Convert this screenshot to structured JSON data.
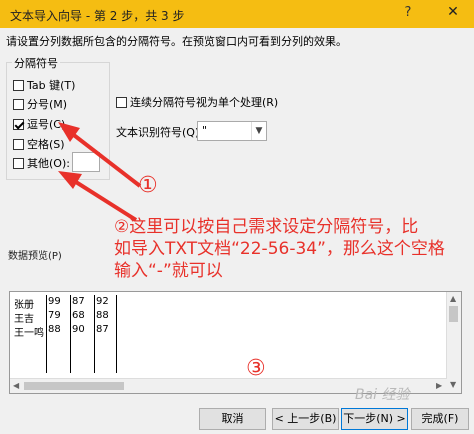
{
  "window": {
    "title": "文本导入向导 - 第 2 步，共 3 步",
    "help": "?",
    "close": "✕"
  },
  "instruction": "请设置分列数据所包含的分隔符号。在预览窗口内可看到分列的效果。",
  "delimiters": {
    "group_label": "分隔符号",
    "tab": {
      "label": "Tab 键(T)",
      "checked": false
    },
    "semicolon": {
      "label": "分号(M)",
      "checked": false
    },
    "comma": {
      "label": "逗号(C)",
      "checked": true
    },
    "space": {
      "label": "空格(S)",
      "checked": false
    },
    "other": {
      "label": "其他(O):",
      "checked": false,
      "value": ""
    }
  },
  "consecutive": {
    "label": "连续分隔符号视为单个处理(R)",
    "checked": false
  },
  "text_qualifier": {
    "label": "文本识别符号(Q):",
    "value": "\""
  },
  "preview": {
    "label": "数据预览(P)",
    "rows": [
      [
        "张册",
        "99",
        "87",
        "92"
      ],
      [
        "王吉",
        "79",
        "68",
        "88"
      ],
      [
        "王一鸣",
        "88",
        "90",
        "87"
      ]
    ]
  },
  "buttons": {
    "cancel": "取消",
    "back": "< 上一步(B)",
    "next": "下一步(N) >",
    "finish": "完成(F)"
  },
  "annotations": {
    "circle1": "①",
    "line1": "②这里可以按自己需求设定分隔符号，比",
    "line2": "如导入TXT文档“22-56-34”，那么这个空格",
    "line3": "输入“-”就可以",
    "circle3": "③",
    "color": "#e8312a"
  },
  "watermark": "Bai 经验"
}
